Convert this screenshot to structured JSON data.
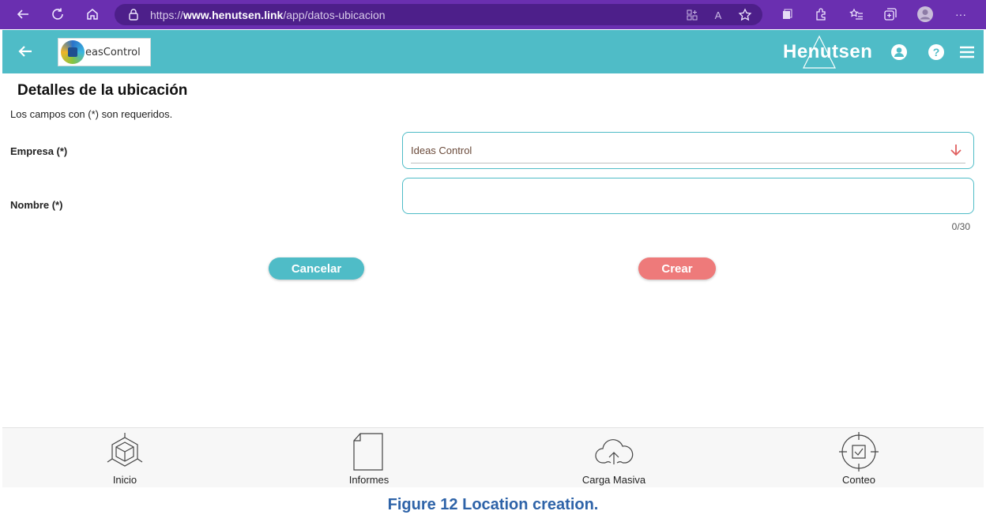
{
  "browser": {
    "url_prefix": "https://",
    "url_host": "www.henutsen.link",
    "url_path": "/app/datos-ubicacion"
  },
  "header": {
    "logo_text": "easControl",
    "brand": "Henutsen"
  },
  "form": {
    "title": "Detalles de la ubicación",
    "required_note": "Los campos con (*) son requeridos.",
    "empresa_label": "Empresa (*)",
    "empresa_value": "Ideas Control",
    "nombre_label": "Nombre (*)",
    "nombre_value": "",
    "nombre_counter": "0/30",
    "cancel_label": "Cancelar",
    "create_label": "Crear"
  },
  "bottom_nav": [
    {
      "label": "Inicio",
      "icon": "cube-home-icon"
    },
    {
      "label": "Informes",
      "icon": "document-icon"
    },
    {
      "label": "Carga Masiva",
      "icon": "cloud-upload-icon"
    },
    {
      "label": "Conteo",
      "icon": "target-check-icon"
    }
  ],
  "caption": "Figure 12 Location creation.",
  "colors": {
    "browser_bar": "#6a2fb0",
    "header": "#4fbcc7",
    "cancel_button": "#4fbcc7",
    "create_button": "#ee7a7a",
    "caption": "#2e63a8"
  }
}
